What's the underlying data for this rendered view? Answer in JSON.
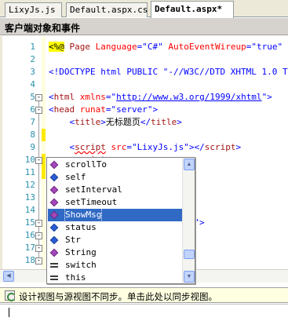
{
  "tabs": [
    {
      "label": "LixyJs.js"
    },
    {
      "label": "Default.aspx.cs"
    },
    {
      "label": "Default.aspx*"
    }
  ],
  "header": {
    "title": "客户端对象和事件"
  },
  "lines": [
    {
      "num": "1",
      "parts": [
        {
          "t": "<%@",
          "c": "hl"
        },
        {
          "t": " Page ",
          "c": "maroon"
        },
        {
          "t": "Language",
          "c": "red"
        },
        {
          "t": "=",
          "c": "blue"
        },
        {
          "t": "\"C#\"",
          "c": "blue"
        },
        {
          "t": " AutoEventWireup",
          "c": "red"
        },
        {
          "t": "=",
          "c": "blue"
        },
        {
          "t": "\"true\"",
          "c": "blue"
        },
        {
          "t": "  CodeF",
          "c": "red"
        }
      ]
    },
    {
      "num": "2",
      "parts": []
    },
    {
      "num": "3",
      "parts": [
        {
          "t": "<!DOCTYPE html PUBLIC \"-//W3C//DTD XHTML 1.0 Transiti",
          "c": "blue"
        }
      ]
    },
    {
      "num": "4",
      "parts": []
    },
    {
      "num": "5",
      "parts": [
        {
          "t": "<",
          "c": "blue"
        },
        {
          "t": "html",
          "c": "maroon"
        },
        {
          "t": " xmlns",
          "c": "red"
        },
        {
          "t": "=\"",
          "c": "blue"
        },
        {
          "t": "http://www.w3.org/1999/xhtml",
          "c": "link"
        },
        {
          "t": "\">",
          "c": "blue"
        }
      ]
    },
    {
      "num": "6",
      "parts": [
        {
          "t": "<",
          "c": "blue"
        },
        {
          "t": "head",
          "c": "maroon"
        },
        {
          "t": " runat",
          "c": "red"
        },
        {
          "t": "=\"server\">",
          "c": "blue"
        }
      ]
    },
    {
      "num": "7",
      "parts": [
        {
          "t": "    <",
          "c": "blue"
        },
        {
          "t": "title",
          "c": "maroon"
        },
        {
          "t": ">",
          "c": "blue"
        },
        {
          "t": "无标题页",
          "c": "black"
        },
        {
          "t": "</",
          "c": "blue"
        },
        {
          "t": "title",
          "c": "maroon"
        },
        {
          "t": ">",
          "c": "blue"
        }
      ]
    },
    {
      "num": "8",
      "parts": []
    },
    {
      "num": "9",
      "parts": [
        {
          "t": "    <",
          "c": "blue"
        },
        {
          "t": "script",
          "c": "maroon squig"
        },
        {
          "t": " src",
          "c": "red"
        },
        {
          "t": "=\"LixyJs.js\"></",
          "c": "blue"
        },
        {
          "t": "script",
          "c": "maroon"
        },
        {
          "t": ">",
          "c": "blue"
        }
      ]
    },
    {
      "num": "10",
      "parts": [
        {
          "t": "    <",
          "c": "blue"
        },
        {
          "t": "script",
          "c": "maroon squig"
        },
        {
          "t": ">",
          "c": "blue"
        }
      ]
    },
    {
      "num": "11",
      "parts": [
        {
          "t": "    sho",
          "c": "black"
        }
      ]
    },
    {
      "num": "12",
      "parts": []
    },
    {
      "num": "13",
      "parts": []
    },
    {
      "num": "14",
      "parts": []
    },
    {
      "num": "15",
      "parts": [
        {
          "t": "                           r\">",
          "c": "blue"
        }
      ]
    },
    {
      "num": "16",
      "parts": []
    },
    {
      "num": "17",
      "parts": []
    },
    {
      "num": "18",
      "parts": []
    },
    {
      "num": "19",
      "parts": []
    },
    {
      "num": "20",
      "parts": []
    },
    {
      "num": "21",
      "parts": []
    }
  ],
  "autocomplete": {
    "items": [
      {
        "label": "scrollTo",
        "icon": "method-icon"
      },
      {
        "label": "self",
        "icon": "property-icon"
      },
      {
        "label": "setInterval",
        "icon": "method-icon"
      },
      {
        "label": "setTimeout",
        "icon": "method-icon"
      },
      {
        "label": "ShowMsg",
        "icon": "method-icon",
        "selected": true
      },
      {
        "label": "status",
        "icon": "property-icon"
      },
      {
        "label": "Str",
        "icon": "property-icon"
      },
      {
        "label": "String",
        "icon": "method-icon"
      },
      {
        "label": "switch",
        "icon": "keyword-icon"
      },
      {
        "label": "this",
        "icon": "keyword-icon"
      }
    ]
  },
  "status": {
    "message": "设计视图与源视图不同步。单击此处以同步视图。"
  },
  "colors": {
    "selection": "#316ac5",
    "keyword": "#0000ff",
    "tag": "#a31515",
    "attribute": "#ff0000",
    "line_number": "#2b91af"
  }
}
